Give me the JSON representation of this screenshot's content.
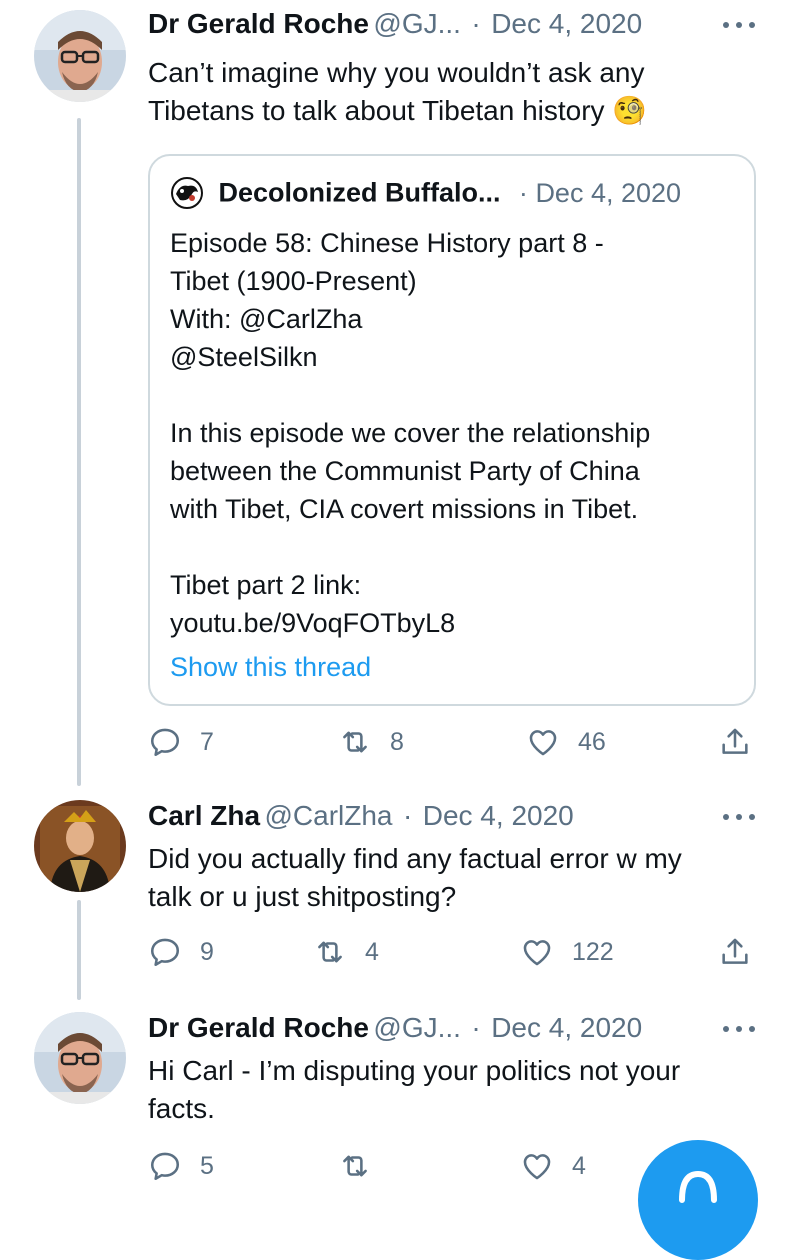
{
  "tweets": [
    {
      "author_name": "Dr Gerald Roche",
      "handle": "@GJ...",
      "separator": "·",
      "date": "Dec 4, 2020",
      "text": "Can’t imagine why you wouldn’t ask any\nTibetans to talk about Tibetan history",
      "emoji": "🧐",
      "avatar_icon": "person-glasses-avatar",
      "quoted": {
        "author_name": "Decolonized Buffalo...",
        "separator": "·",
        "date": "Dec 4, 2020",
        "text": "Episode 58: Chinese History part 8 -\nTibet (1900-Present)\nWith: @CarlZha\n@SteelSilkn\n\nIn this episode we cover the relationship\nbetween the Communist Party of China\nwith Tibet, CIA covert missions in Tibet.\n\nTibet part 2 link:\nyoutu.be/9VoqFOTbyL8",
        "show_thread": "Show this thread"
      },
      "replies": "7",
      "retweets": "8",
      "likes": "46"
    },
    {
      "author_name": "Carl Zha",
      "handle": "@CarlZha",
      "separator": "·",
      "date": "Dec 4, 2020",
      "text": "Did you actually find any factual error w my\ntalk or u just shitposting?",
      "avatar_icon": "portrait-avatar",
      "replies": "9",
      "retweets": "4",
      "likes": "122"
    },
    {
      "author_name": "Dr Gerald Roche",
      "handle": "@GJ...",
      "separator": "·",
      "date": "Dec 4, 2020",
      "text": "Hi Carl - I’m disputing your politics not your\nfacts.",
      "avatar_icon": "person-glasses-avatar",
      "replies": "5",
      "retweets": "",
      "likes": "4"
    }
  ],
  "colors": {
    "link": "#1d9bf0",
    "secondary_text": "#5b7083",
    "border": "#cfd9de",
    "thread_line": "#c8d1d9",
    "fab": "#1d9bf0"
  },
  "icons": {
    "reply": "reply-icon",
    "retweet": "retweet-icon",
    "like": "heart-icon",
    "share": "share-icon",
    "more": "more-icon",
    "compose": "compose-icon"
  }
}
